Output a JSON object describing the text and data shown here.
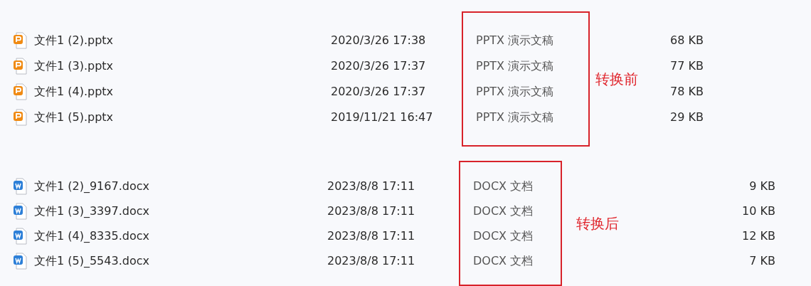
{
  "groups": [
    {
      "label": "转换前",
      "files": [
        {
          "kind": "presentation",
          "name": "文件1 (2).pptx",
          "date": "2020/3/26 17:38",
          "type": "PPTX 演示文稿",
          "size": "68 KB"
        },
        {
          "kind": "presentation",
          "name": "文件1 (3).pptx",
          "date": "2020/3/26 17:37",
          "type": "PPTX 演示文稿",
          "size": "77 KB"
        },
        {
          "kind": "presentation",
          "name": "文件1 (4).pptx",
          "date": "2020/3/26 17:37",
          "type": "PPTX 演示文稿",
          "size": "78 KB"
        },
        {
          "kind": "presentation",
          "name": "文件1 (5).pptx",
          "date": "2019/11/21 16:47",
          "type": "PPTX 演示文稿",
          "size": "29 KB"
        }
      ]
    },
    {
      "label": "转换后",
      "files": [
        {
          "kind": "document",
          "name": "文件1 (2)_9167.docx",
          "date": "2023/8/8 17:11",
          "type": "DOCX 文档",
          "size": "9 KB"
        },
        {
          "kind": "document",
          "name": "文件1 (3)_3397.docx",
          "date": "2023/8/8 17:11",
          "type": "DOCX 文档",
          "size": "10 KB"
        },
        {
          "kind": "document",
          "name": "文件1 (4)_8335.docx",
          "date": "2023/8/8 17:11",
          "type": "DOCX 文档",
          "size": "12 KB"
        },
        {
          "kind": "document",
          "name": "文件1 (5)_5543.docx",
          "date": "2023/8/8 17:11",
          "type": "DOCX 文档",
          "size": "7 KB"
        }
      ]
    }
  ]
}
